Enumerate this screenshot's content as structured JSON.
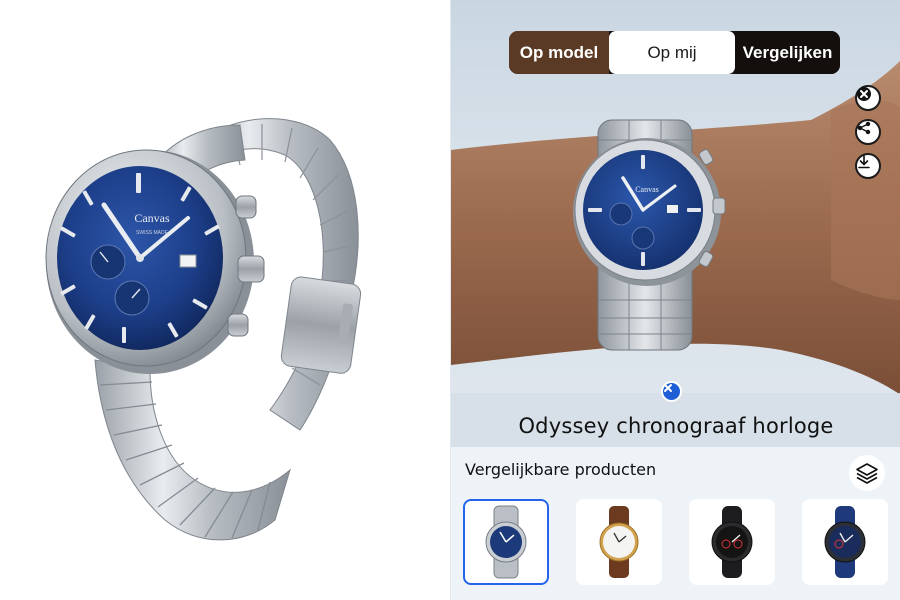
{
  "product_image": {
    "brand_text": "Canvas",
    "dial_sub_text": "SWISS MADE"
  },
  "tryon": {
    "modes": [
      {
        "label": "Op model",
        "active": false
      },
      {
        "label": "Op mij",
        "active": true
      },
      {
        "label": "Vergelijken",
        "active": false
      }
    ],
    "actions": {
      "close": "close-icon",
      "share": "share-icon",
      "download": "download-icon"
    },
    "caption": "Odyssey chronograaf horloge",
    "watch_brand_text": "Canvas"
  },
  "similar": {
    "title": "Vergelijkbare producten",
    "layers_icon": "layers-icon",
    "items": [
      {
        "name": "steel-blue-chrono",
        "dial": "#1c3a7a",
        "strap": "steel",
        "selected": true
      },
      {
        "name": "gold-white-leather",
        "dial": "#f4f4f2",
        "strap": "brown",
        "selected": false
      },
      {
        "name": "black-sport-rubber",
        "dial": "#141414",
        "strap": "black",
        "selected": false
      },
      {
        "name": "blue-sport-rubber",
        "dial": "#1a2c5c",
        "strap": "navy",
        "selected": false
      }
    ]
  },
  "colors": {
    "accent_blue": "#2563eb",
    "switch_model_bg": "#5a3a24",
    "switch_dark": "#140e0c",
    "dial_blue": "#1d3f8a"
  }
}
